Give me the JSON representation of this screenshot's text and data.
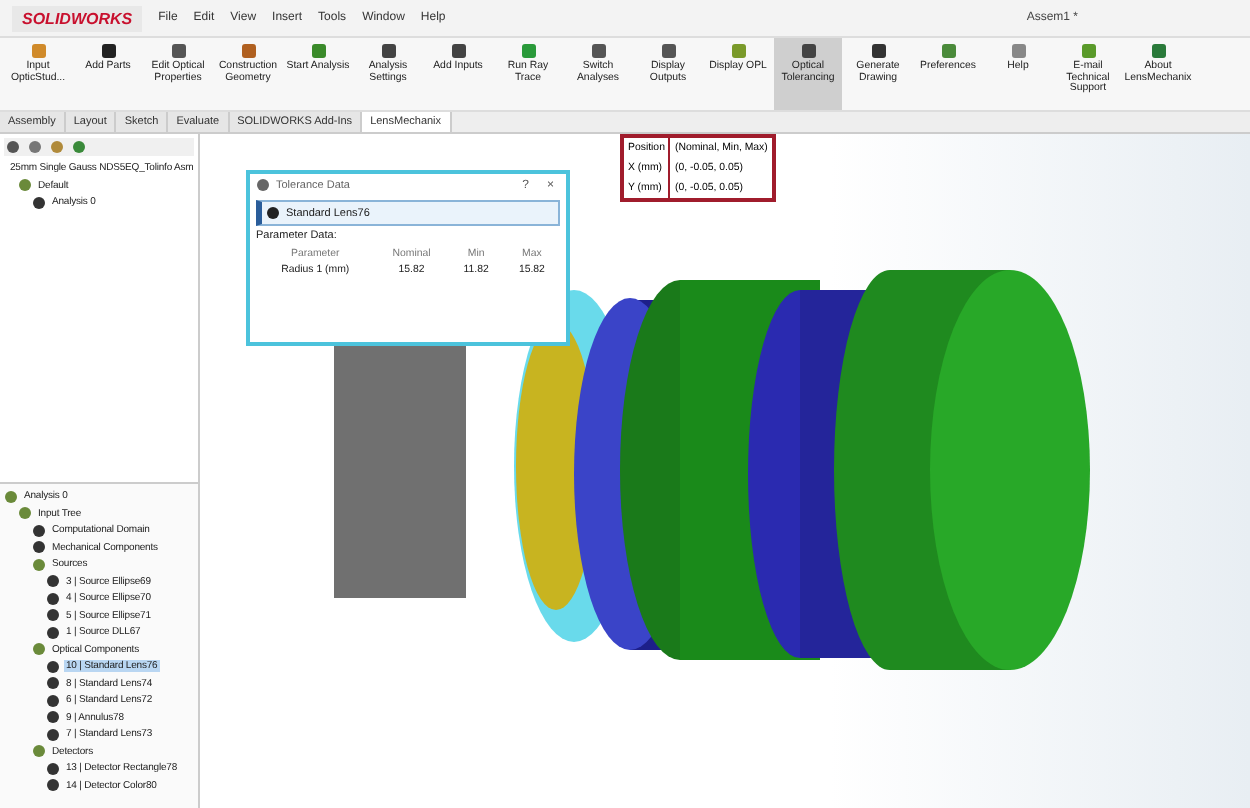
{
  "app": {
    "logo": "SOLIDWORKS",
    "title": "Assem1 *"
  },
  "menu": [
    "File",
    "Edit",
    "View",
    "Insert",
    "Tools",
    "Window",
    "Help"
  ],
  "ribbon": [
    {
      "label": "Input OpticStud...",
      "selected": false
    },
    {
      "label": "Add Parts",
      "selected": false
    },
    {
      "label": "Edit Optical Properties",
      "selected": false
    },
    {
      "label": "Construction Geometry",
      "selected": false
    },
    {
      "label": "Start Analysis",
      "selected": false
    },
    {
      "label": "Analysis Settings",
      "selected": false
    },
    {
      "label": "Add Inputs",
      "selected": false
    },
    {
      "label": "Run Ray Trace",
      "selected": false
    },
    {
      "label": "Switch Analyses",
      "selected": false
    },
    {
      "label": "Display Outputs",
      "selected": false
    },
    {
      "label": "Display OPL",
      "selected": false
    },
    {
      "label": "Optical Tolerancing",
      "selected": true
    },
    {
      "label": "Generate Drawing",
      "selected": false
    },
    {
      "label": "Preferences",
      "selected": false
    },
    {
      "label": "Help",
      "selected": false
    },
    {
      "label": "E-mail Technical Support",
      "selected": false
    },
    {
      "label": "About LensMechanix",
      "selected": false
    }
  ],
  "tabs": [
    {
      "label": "Assembly",
      "selected": false
    },
    {
      "label": "Layout",
      "selected": false
    },
    {
      "label": "Sketch",
      "selected": false
    },
    {
      "label": "Evaluate",
      "selected": false
    },
    {
      "label": "SOLIDWORKS Add-Ins",
      "selected": false
    },
    {
      "label": "LensMechanix",
      "selected": true
    }
  ],
  "feature_tree": [
    {
      "label": "25mm Single Gauss NDS5EQ_Tolinfo Asm",
      "children": [
        {
          "label": "Default",
          "children": [
            {
              "label": "Analysis 0"
            }
          ]
        }
      ]
    }
  ],
  "analysis_tree": [
    {
      "label": "Analysis 0",
      "children": [
        {
          "label": "Input Tree",
          "children": [
            {
              "label": "Computational Domain"
            },
            {
              "label": "Mechanical Components"
            },
            {
              "label": "Sources",
              "children": [
                {
                  "label": "3 | Source Ellipse69"
                },
                {
                  "label": "4 | Source Ellipse70"
                },
                {
                  "label": "5 | Source Ellipse71"
                },
                {
                  "label": "1 | Source DLL67"
                }
              ]
            },
            {
              "label": "Optical Components",
              "children": [
                {
                  "label": "10 | Standard Lens76",
                  "selected": true
                },
                {
                  "label": "8 | Standard Lens74",
                  "selected": false
                },
                {
                  "label": "6 | Standard Lens72",
                  "selected": false
                },
                {
                  "label": "9 | Annulus78",
                  "selected": false
                },
                {
                  "label": "7 | Standard Lens73",
                  "selected": false
                }
              ]
            },
            {
              "label": "Detectors",
              "children": [
                {
                  "label": "13 | Detector Rectangle78"
                },
                {
                  "label": "14 | Detector Color80"
                }
              ]
            }
          ]
        }
      ]
    }
  ],
  "dialog": {
    "title": "Tolerance Data",
    "help": "?",
    "close": "×",
    "item": "Standard Lens76",
    "section": "Parameter Data:",
    "columns": [
      "Parameter",
      "Nominal",
      "Min",
      "Max"
    ],
    "rows": [
      [
        "Radius 1 (mm)",
        "15.82",
        "11.82",
        "15.82"
      ]
    ]
  },
  "tooltip": {
    "rows": [
      [
        "Position",
        "(Nominal, Min, Max)"
      ],
      [
        "X (mm)",
        "(0, -0.05, 0.05)"
      ],
      [
        "Y (mm)",
        "(0, -0.05, 0.05)"
      ]
    ]
  }
}
